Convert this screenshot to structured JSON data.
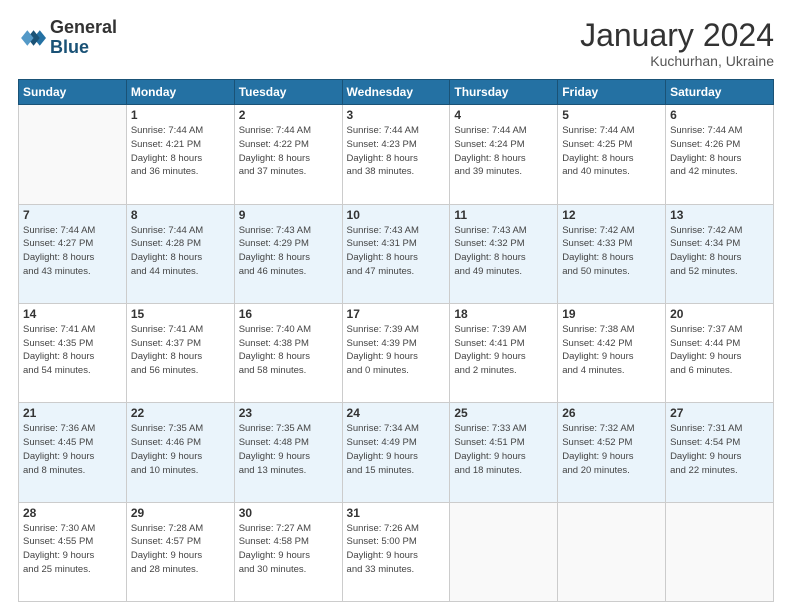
{
  "header": {
    "logo_general": "General",
    "logo_blue": "Blue",
    "month_title": "January 2024",
    "subtitle": "Kuchurhan, Ukraine"
  },
  "days_of_week": [
    "Sunday",
    "Monday",
    "Tuesday",
    "Wednesday",
    "Thursday",
    "Friday",
    "Saturday"
  ],
  "weeks": [
    [
      {
        "num": "",
        "info": ""
      },
      {
        "num": "1",
        "info": "Sunrise: 7:44 AM\nSunset: 4:21 PM\nDaylight: 8 hours\nand 36 minutes."
      },
      {
        "num": "2",
        "info": "Sunrise: 7:44 AM\nSunset: 4:22 PM\nDaylight: 8 hours\nand 37 minutes."
      },
      {
        "num": "3",
        "info": "Sunrise: 7:44 AM\nSunset: 4:23 PM\nDaylight: 8 hours\nand 38 minutes."
      },
      {
        "num": "4",
        "info": "Sunrise: 7:44 AM\nSunset: 4:24 PM\nDaylight: 8 hours\nand 39 minutes."
      },
      {
        "num": "5",
        "info": "Sunrise: 7:44 AM\nSunset: 4:25 PM\nDaylight: 8 hours\nand 40 minutes."
      },
      {
        "num": "6",
        "info": "Sunrise: 7:44 AM\nSunset: 4:26 PM\nDaylight: 8 hours\nand 42 minutes."
      }
    ],
    [
      {
        "num": "7",
        "info": "Sunrise: 7:44 AM\nSunset: 4:27 PM\nDaylight: 8 hours\nand 43 minutes."
      },
      {
        "num": "8",
        "info": "Sunrise: 7:44 AM\nSunset: 4:28 PM\nDaylight: 8 hours\nand 44 minutes."
      },
      {
        "num": "9",
        "info": "Sunrise: 7:43 AM\nSunset: 4:29 PM\nDaylight: 8 hours\nand 46 minutes."
      },
      {
        "num": "10",
        "info": "Sunrise: 7:43 AM\nSunset: 4:31 PM\nDaylight: 8 hours\nand 47 minutes."
      },
      {
        "num": "11",
        "info": "Sunrise: 7:43 AM\nSunset: 4:32 PM\nDaylight: 8 hours\nand 49 minutes."
      },
      {
        "num": "12",
        "info": "Sunrise: 7:42 AM\nSunset: 4:33 PM\nDaylight: 8 hours\nand 50 minutes."
      },
      {
        "num": "13",
        "info": "Sunrise: 7:42 AM\nSunset: 4:34 PM\nDaylight: 8 hours\nand 52 minutes."
      }
    ],
    [
      {
        "num": "14",
        "info": "Sunrise: 7:41 AM\nSunset: 4:35 PM\nDaylight: 8 hours\nand 54 minutes."
      },
      {
        "num": "15",
        "info": "Sunrise: 7:41 AM\nSunset: 4:37 PM\nDaylight: 8 hours\nand 56 minutes."
      },
      {
        "num": "16",
        "info": "Sunrise: 7:40 AM\nSunset: 4:38 PM\nDaylight: 8 hours\nand 58 minutes."
      },
      {
        "num": "17",
        "info": "Sunrise: 7:39 AM\nSunset: 4:39 PM\nDaylight: 9 hours\nand 0 minutes."
      },
      {
        "num": "18",
        "info": "Sunrise: 7:39 AM\nSunset: 4:41 PM\nDaylight: 9 hours\nand 2 minutes."
      },
      {
        "num": "19",
        "info": "Sunrise: 7:38 AM\nSunset: 4:42 PM\nDaylight: 9 hours\nand 4 minutes."
      },
      {
        "num": "20",
        "info": "Sunrise: 7:37 AM\nSunset: 4:44 PM\nDaylight: 9 hours\nand 6 minutes."
      }
    ],
    [
      {
        "num": "21",
        "info": "Sunrise: 7:36 AM\nSunset: 4:45 PM\nDaylight: 9 hours\nand 8 minutes."
      },
      {
        "num": "22",
        "info": "Sunrise: 7:35 AM\nSunset: 4:46 PM\nDaylight: 9 hours\nand 10 minutes."
      },
      {
        "num": "23",
        "info": "Sunrise: 7:35 AM\nSunset: 4:48 PM\nDaylight: 9 hours\nand 13 minutes."
      },
      {
        "num": "24",
        "info": "Sunrise: 7:34 AM\nSunset: 4:49 PM\nDaylight: 9 hours\nand 15 minutes."
      },
      {
        "num": "25",
        "info": "Sunrise: 7:33 AM\nSunset: 4:51 PM\nDaylight: 9 hours\nand 18 minutes."
      },
      {
        "num": "26",
        "info": "Sunrise: 7:32 AM\nSunset: 4:52 PM\nDaylight: 9 hours\nand 20 minutes."
      },
      {
        "num": "27",
        "info": "Sunrise: 7:31 AM\nSunset: 4:54 PM\nDaylight: 9 hours\nand 22 minutes."
      }
    ],
    [
      {
        "num": "28",
        "info": "Sunrise: 7:30 AM\nSunset: 4:55 PM\nDaylight: 9 hours\nand 25 minutes."
      },
      {
        "num": "29",
        "info": "Sunrise: 7:28 AM\nSunset: 4:57 PM\nDaylight: 9 hours\nand 28 minutes."
      },
      {
        "num": "30",
        "info": "Sunrise: 7:27 AM\nSunset: 4:58 PM\nDaylight: 9 hours\nand 30 minutes."
      },
      {
        "num": "31",
        "info": "Sunrise: 7:26 AM\nSunset: 5:00 PM\nDaylight: 9 hours\nand 33 minutes."
      },
      {
        "num": "",
        "info": ""
      },
      {
        "num": "",
        "info": ""
      },
      {
        "num": "",
        "info": ""
      }
    ]
  ]
}
